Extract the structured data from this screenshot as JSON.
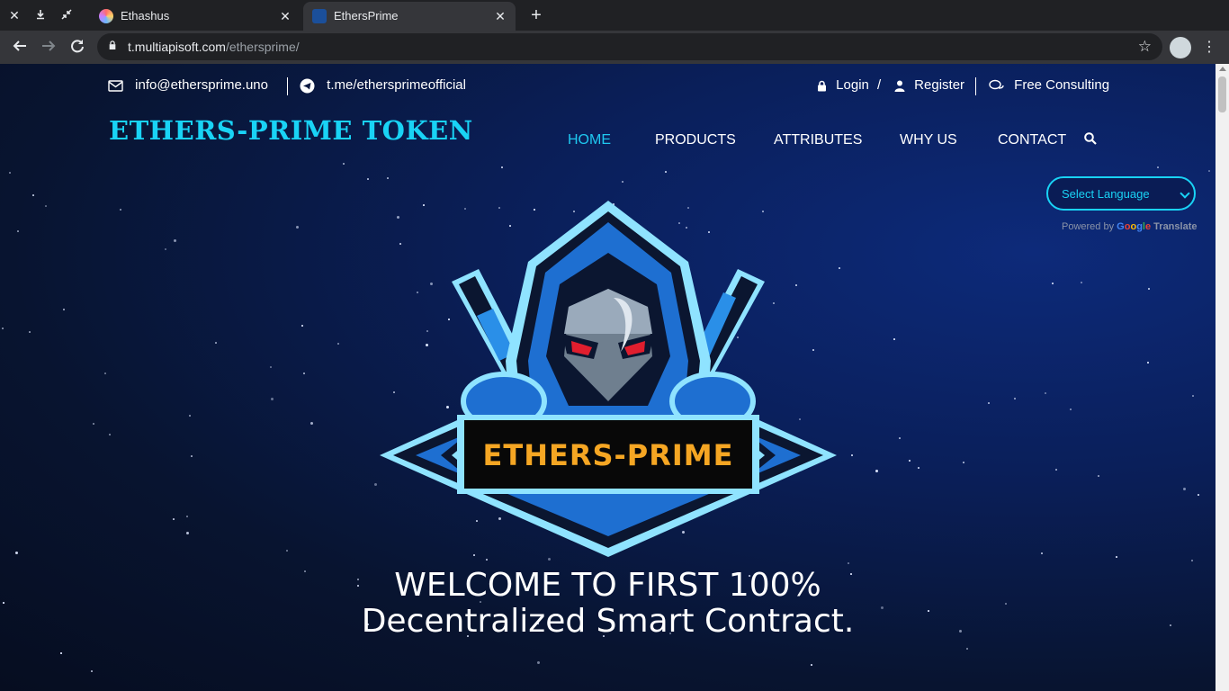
{
  "browser": {
    "tabs": [
      {
        "title": "Ethashus",
        "active": false
      },
      {
        "title": "EthersPrime",
        "active": true
      }
    ],
    "url_host": "t.multiapisoft.com",
    "url_path": "/ethersprime/"
  },
  "topbar": {
    "email": "info@ethersprime.uno",
    "telegram": "t.me/ethersprimeofficial",
    "login": "Login",
    "divider": "/",
    "register": "Register",
    "consulting": "Free Consulting"
  },
  "header": {
    "brand": "ETHERS-PRIME TOKEN",
    "nav": [
      "HOME",
      "PRODUCTS",
      "ATTRIBUTES",
      "WHY US",
      "CONTACT"
    ],
    "active_nav": "HOME"
  },
  "translate": {
    "select_label": "Select Language",
    "powered_by": "Powered by",
    "google": "Google",
    "translate": "Translate"
  },
  "logo": {
    "text": "ETHERS-PRIME"
  },
  "hero": {
    "line1": "WELCOME TO FIRST 100%",
    "line2": "Decentralized Smart Contract."
  },
  "colors": {
    "accent": "#19d3f5",
    "logo_text": "#f5a623",
    "page_bg": "#081430"
  }
}
